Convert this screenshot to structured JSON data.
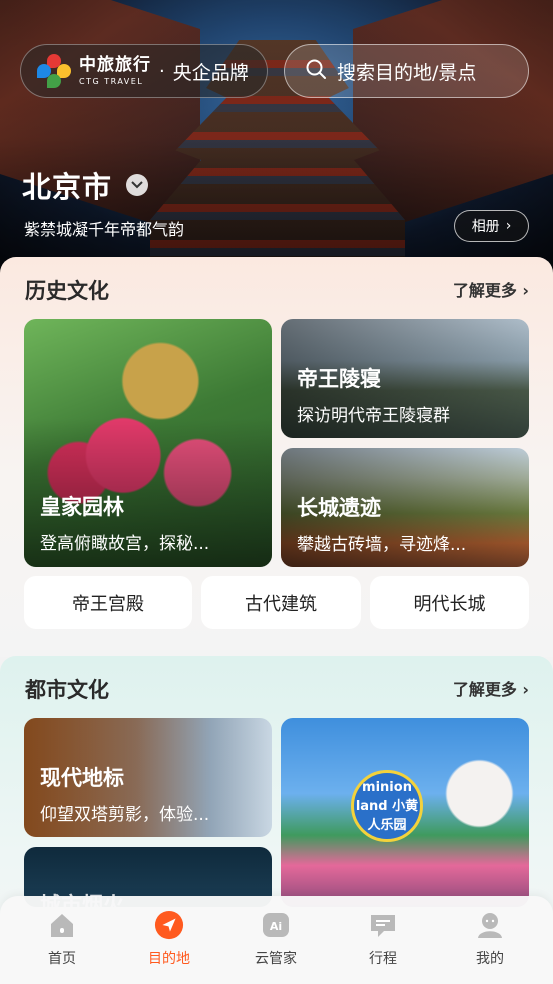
{
  "header": {
    "brand_cn": "中旅旅行",
    "brand_en": "CTG TRAVEL",
    "brand_separator": "·",
    "brand_tag": "央企品牌",
    "search_placeholder": "搜索目的地/景点",
    "city": "北京市",
    "subtitle": "紫禁城凝千年帝都气韵",
    "album_label": "相册",
    "album_chevron": "›"
  },
  "history": {
    "title": "历史文化",
    "more_label": "了解更多",
    "more_chevron": "›",
    "cards": [
      {
        "title": "皇家园林",
        "subtitle": "登高俯瞰故宫，探秘..."
      },
      {
        "title": "帝王陵寝",
        "subtitle": "探访明代帝王陵寝群"
      },
      {
        "title": "长城遗迹",
        "subtitle": "攀越古砖墙，寻迹烽..."
      }
    ],
    "tags": [
      "帝王宫殿",
      "古代建筑",
      "明代长城"
    ]
  },
  "urban": {
    "title": "都市文化",
    "more_label": "了解更多",
    "more_chevron": "›",
    "cards": [
      {
        "title": "现代地标",
        "subtitle": "仰望双塔剪影，体验..."
      },
      {
        "title": "城市烟火",
        "subtitle": ""
      }
    ],
    "minion_sign": "minion land 小黄人乐园"
  },
  "tabbar": {
    "items": [
      {
        "label": "首页",
        "icon": "home-icon",
        "active": false
      },
      {
        "label": "目的地",
        "icon": "navigation-arrow-icon",
        "active": true
      },
      {
        "label": "云管家",
        "icon": "ai-assistant-icon",
        "active": false
      },
      {
        "label": "行程",
        "icon": "itinerary-chat-icon",
        "active": false
      },
      {
        "label": "我的",
        "icon": "profile-icon",
        "active": false
      }
    ]
  },
  "colors": {
    "accent": "#ff5a1f",
    "history_bg": "#fbe9e0",
    "urban_bg": "#def2ee"
  }
}
